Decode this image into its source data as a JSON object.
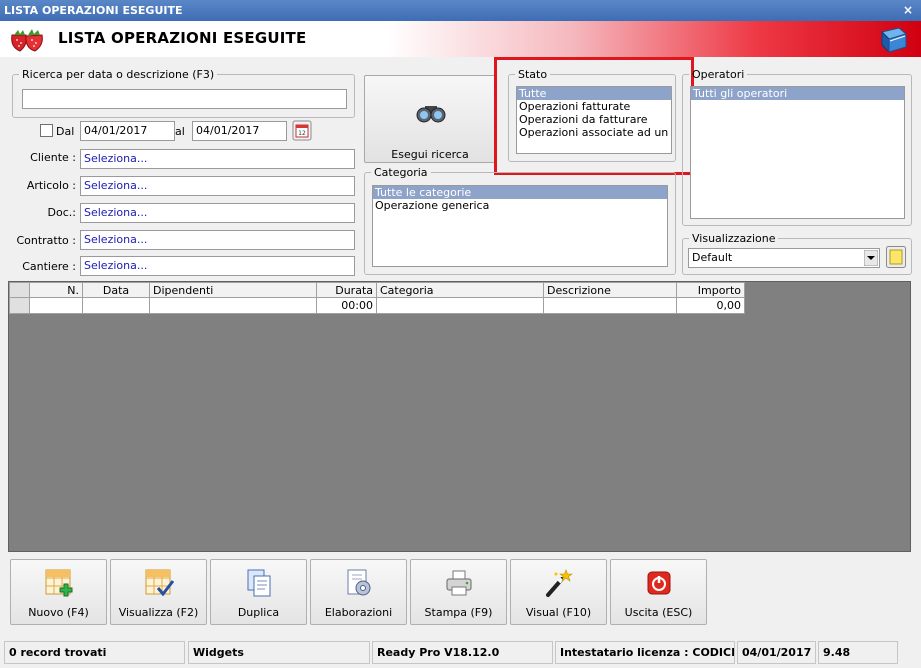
{
  "window": {
    "title": "LISTA OPERAZIONI ESEGUITE",
    "close_glyph": "×"
  },
  "header": {
    "title": "LISTA OPERAZIONI ESEGUITE"
  },
  "search": {
    "legend": "Ricerca per data o descrizione (F3)",
    "value": ""
  },
  "dates": {
    "dal_label": "Dal",
    "dal_value": "04/01/2017",
    "al_label": "al",
    "al_value": "04/01/2017"
  },
  "fields": [
    {
      "label": "Cliente :",
      "value": "Seleziona..."
    },
    {
      "label": "Articolo :",
      "value": "Seleziona..."
    },
    {
      "label": "Doc.:",
      "value": "Seleziona..."
    },
    {
      "label": "Contratto :",
      "value": "Seleziona..."
    },
    {
      "label": "Cantiere :",
      "value": "Seleziona..."
    }
  ],
  "search_button": {
    "label": "Esegui ricerca"
  },
  "stato": {
    "legend": "Stato",
    "items": [
      "Tutte",
      "Operazioni fatturate",
      "Operazioni da fatturare",
      "Operazioni associate ad un cliente"
    ]
  },
  "operatori": {
    "legend": "Operatori",
    "items": [
      "Tutti gli operatori"
    ]
  },
  "categoria": {
    "legend": "Categoria",
    "items": [
      "Tutte le categorie",
      "Operazione generica"
    ]
  },
  "visualizzazione": {
    "legend": "Visualizzazione",
    "value": "Default"
  },
  "grid": {
    "columns": [
      "",
      "N.",
      "Data",
      "Dipendenti",
      "Durata",
      "Categoria",
      "Descrizione",
      "Importo"
    ],
    "rows": [
      [
        "",
        "",
        "",
        "",
        "00:00",
        "",
        "",
        "0,00"
      ]
    ]
  },
  "toolbar": [
    {
      "label": "Nuovo (F4)",
      "icon": "new-grid-icon"
    },
    {
      "label": "Visualizza (F2)",
      "icon": "view-grid-icon"
    },
    {
      "label": "Duplica",
      "icon": "duplicate-icon"
    },
    {
      "label": "Elaborazioni",
      "icon": "processing-icon"
    },
    {
      "label": "Stampa (F9)",
      "icon": "printer-icon"
    },
    {
      "label": "Visual (F10)",
      "icon": "magic-wand-icon"
    },
    {
      "label": "Uscita (ESC)",
      "icon": "exit-icon"
    }
  ],
  "status": [
    "0 record trovati",
    "Widgets",
    "Ready Pro V18.12.0",
    "Intestatario licenza : CODICE SF",
    "04/01/2017",
    "9.48"
  ],
  "colors": {
    "title_bar": "#3e6db5",
    "header_red": "#d00010",
    "selection": "#8ea3c9",
    "annotation": "#e0161e",
    "grid_bg": "#808080"
  }
}
